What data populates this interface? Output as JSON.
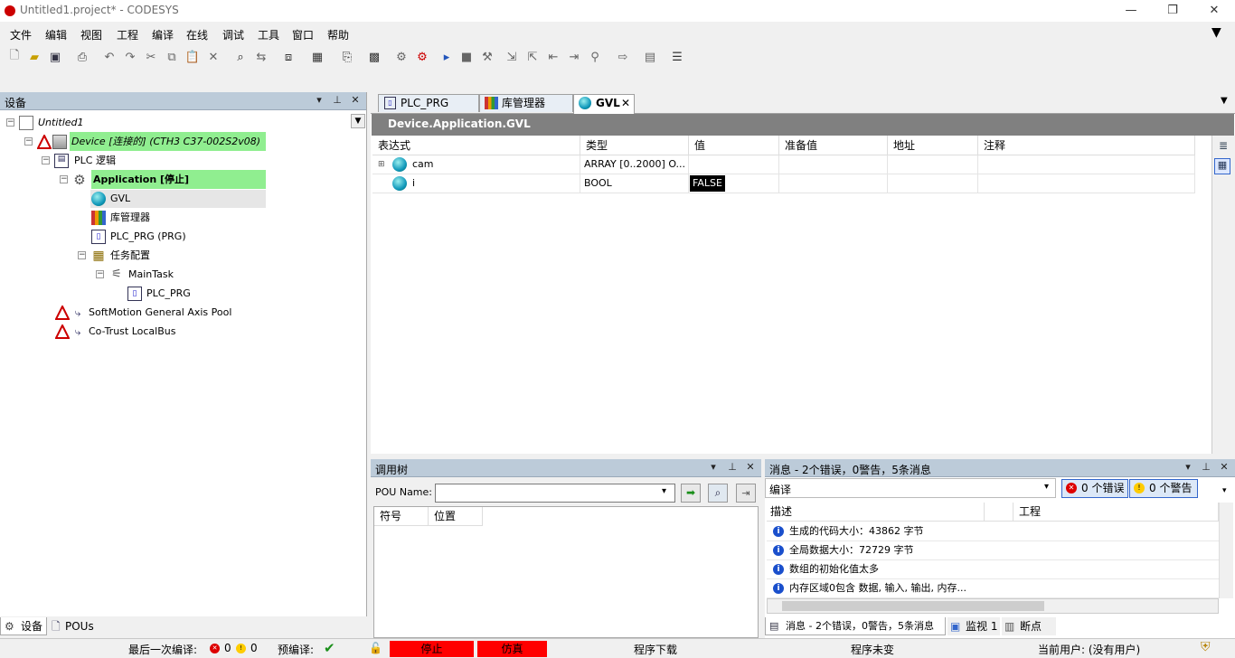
{
  "window": {
    "title": "Untitled1.project* - CODESYS"
  },
  "menu": [
    "文件",
    "编辑",
    "视图",
    "工程",
    "编译",
    "在线",
    "调试",
    "工具",
    "窗口",
    "帮助"
  ],
  "device_panel": {
    "title": "设备",
    "tree": {
      "root": "Untitled1",
      "device": "Device [连接的] (CTH3 C37-002S2v08)",
      "plc_logic": "PLC 逻辑",
      "application": "Application [停止]",
      "gvl": "GVL",
      "library": "库管理器",
      "plc_prg": "PLC_PRG (PRG)",
      "task_config": "任务配置",
      "main_task": "MainTask",
      "task_prg": "PLC_PRG",
      "axis_pool": "SoftMotion General Axis Pool",
      "localbus": "Co-Trust LocalBus"
    },
    "bottom_tabs": [
      "设备",
      "POUs"
    ]
  },
  "editor": {
    "tabs": [
      "PLC_PRG",
      "库管理器",
      "GVL"
    ],
    "active_tab": "GVL",
    "path": "Device.Application.GVL",
    "columns": [
      "表达式",
      "类型",
      "值",
      "准备值",
      "地址",
      "注释"
    ],
    "rows": [
      {
        "expr": "cam",
        "type": "ARRAY [0..2000] O...",
        "value": "",
        "prepared": "",
        "address": "",
        "comment": ""
      },
      {
        "expr": "i",
        "type": "BOOL",
        "value": "FALSE",
        "prepared": "",
        "address": "",
        "comment": ""
      }
    ]
  },
  "call_tree": {
    "title": "调用树",
    "pou_label": "POU Name:",
    "pou_value": "",
    "columns": [
      "符号",
      "位置"
    ]
  },
  "messages": {
    "title": "消息 - 2个错误，0警告，5条消息",
    "filter": "编译",
    "errors_btn": "0 个错误",
    "warnings_btn": "0 个警告",
    "columns": [
      "描述",
      "工程"
    ],
    "rows": [
      "生成的代码大小：43862 字节",
      "全局数据大小：72729 字节",
      "数组的初始化值太多",
      "内存区域0包含 数据, 输入, 输出, 内存..."
    ],
    "bottom_tabs": [
      "消息 - 2个错误，0警告，5条消息",
      "监视 1",
      "断点"
    ]
  },
  "status": {
    "last_compile": "最后一次编译:",
    "err_count": "0",
    "warn_count": "0",
    "precompile": "预编译:",
    "stop": "停止",
    "sim": "仿真",
    "download": "程序下载",
    "unchanged": "程序未变",
    "user": "当前用户: (没有用户)"
  },
  "colors": {
    "panel_header": "#bccbd9",
    "highlight": "#90ee90",
    "status_red": "#ff0000",
    "value_bg": "#000000"
  }
}
